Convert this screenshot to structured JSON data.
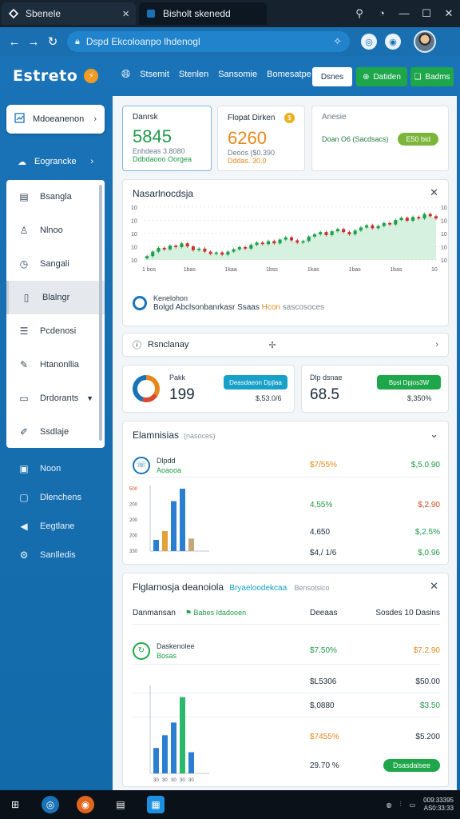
{
  "browser": {
    "tabs": [
      {
        "title": "Sbenele",
        "active": true
      },
      {
        "title": "Bisholt skenedd",
        "active": false
      }
    ],
    "url": "Dspd Ekcoloanpo lhdenogl"
  },
  "app": {
    "logo": "Estreto",
    "top_nav": [
      "Stsemit",
      "Stenlen",
      "Sansomie",
      "Bomesatpe"
    ],
    "buttons": {
      "white": "Dsnes",
      "green1": "Datiden",
      "green2": "Badms"
    }
  },
  "sidebar": {
    "primary": "Mdoeanenon",
    "group": "Eograncke",
    "items": [
      {
        "label": "Bsangla",
        "icon": "document-icon"
      },
      {
        "label": "Nlnoo",
        "icon": "user-icon"
      },
      {
        "label": "Sangali",
        "icon": "clock-icon"
      },
      {
        "label": "Blalngr",
        "icon": "file-icon",
        "selected": true
      },
      {
        "label": "Pcdenosi",
        "icon": "list-icon"
      },
      {
        "label": "Htanonllia",
        "icon": "pen-icon"
      },
      {
        "label": "Drdorants",
        "icon": "folder-icon",
        "chevron": true
      },
      {
        "label": "Ssdlaje",
        "icon": "brush-icon"
      }
    ],
    "lower": [
      {
        "label": "Noon",
        "icon": "image-icon"
      },
      {
        "label": "Dlenchens",
        "icon": "window-icon"
      },
      {
        "label": "Eegtlane",
        "icon": "megaphone-icon"
      },
      {
        "label": "Sanlledis",
        "icon": "gear-icon"
      }
    ]
  },
  "kpis": [
    {
      "label": "Danrsk",
      "value": "5845",
      "sub": "Enhdeas 3.8080",
      "sub2": "Ddbdaooo Oorgea"
    },
    {
      "label": "Flopat Dirken",
      "value": "6260",
      "sub": "Deoos ($0.390",
      "sub2": "Dddas. 30.0"
    },
    {
      "label": "Anesie",
      "row_text": "Doan O6 (Sacdsacs)",
      "pill": "E50 bid"
    }
  ],
  "main_chart": {
    "title": "Nasarlnocdsja",
    "footer_line1": "Kenelohon",
    "footer_line2": "Bolgd Abclsonbanrkasr Ssaas",
    "footer_orange": "Hcon",
    "footer_grey": "sascosoces"
  },
  "chart_data": {
    "type": "candlestick",
    "x_tick_labels": [
      "1 bos",
      "1bas",
      "1kaa",
      "1bss",
      "1kas",
      "1bas",
      "1bas",
      "10"
    ],
    "y_tick_labels": [
      "10",
      "10",
      "10",
      "10",
      "10"
    ],
    "close": [
      2.0,
      2.6,
      3.1,
      2.9,
      3.4,
      3.2,
      3.7,
      3.3,
      2.8,
      3.0,
      2.6,
      2.3,
      2.5,
      2.2,
      2.6,
      2.9,
      3.2,
      3.0,
      3.5,
      3.8,
      3.6,
      4.0,
      3.7,
      4.2,
      4.5,
      4.1,
      3.8,
      4.0,
      4.6,
      4.9,
      5.2,
      4.8,
      5.3,
      5.6,
      5.2,
      4.9,
      5.4,
      5.8,
      6.1,
      5.7,
      6.0,
      6.4,
      6.2,
      6.8,
      7.1,
      6.7,
      7.2,
      7.0,
      7.6,
      7.3,
      7.0
    ]
  },
  "summary_row": {
    "label": "Rsnclanay"
  },
  "mini_cards": [
    {
      "label": "Pakk",
      "value": "199",
      "pill": "Deasdaeon Dpjlaa",
      "sub": "$,53.0/6"
    },
    {
      "label": "Dlp dsnae",
      "value": "68.5",
      "pill": "Bpsi Dpjos3W",
      "sub": "$,350%"
    }
  ],
  "table1": {
    "title": "Elamnisias",
    "subtitle": "(nasoces)",
    "rows": [
      {
        "l1": "Dlpdd",
        "l2": "Aoaooa",
        "mid": "$7/55%",
        "right": "$,5.0.90"
      },
      {
        "l1": "",
        "l2": "",
        "mid": "4,55%",
        "right": "$,2.90"
      },
      {
        "l1": "",
        "l2": "",
        "mid": "4,650",
        "right": "$,2.5%"
      },
      {
        "l1": "",
        "l2": "",
        "mid": "$4,/ 1/6",
        "right": "$,0.96"
      }
    ],
    "bars_y_labels": [
      "500",
      "200",
      "200",
      "200",
      "330"
    ],
    "bars": [
      {
        "value": 0.18,
        "color": "#2a7fd0"
      },
      {
        "value": 0.32,
        "color": "#e0a23a"
      },
      {
        "value": 0.8,
        "color": "#2a7fd0"
      },
      {
        "value": 1.0,
        "color": "#2a7fd0"
      },
      {
        "value": 0.2,
        "color": "#c6a77a"
      }
    ]
  },
  "table2": {
    "title": "Flglarnosja deanoiola",
    "link": "Bryaeloodekcaa",
    "muted": "Bensotsico",
    "header": {
      "c1": "Danmansan",
      "tag": "Babes Idadooen",
      "c2": "Deeaas",
      "c3": "Sosdes 10 Dasins"
    },
    "rows": [
      {
        "l1": "Daskenolee",
        "l2": "Bosas",
        "mid": "$7.50%",
        "right": "$7.2.90"
      },
      {
        "l1": "",
        "l2": "",
        "mid": "$L5306",
        "right": "$50.00"
      },
      {
        "l1": "",
        "l2": "",
        "mid": "$,0880",
        "right": "$3.50"
      },
      {
        "l1": "",
        "l2": "",
        "mid": "$7455%",
        "right": "$5.200"
      },
      {
        "l1": "",
        "l2": "",
        "mid": "29.70 %",
        "right": ""
      }
    ],
    "button": "Dsasdalsee",
    "bars_x_labels": [
      "30",
      "30",
      "30",
      "30",
      "30"
    ],
    "bars": [
      {
        "value": 0.3,
        "color": "#2a7fd0"
      },
      {
        "value": 0.45,
        "color": "#2a7fd0"
      },
      {
        "value": 0.6,
        "color": "#2a7fd0"
      },
      {
        "value": 0.9,
        "color": "#2cb86a"
      },
      {
        "value": 0.25,
        "color": "#2a7fd0"
      }
    ]
  },
  "taskbar": {
    "clock1": "009:33395",
    "clock2": "AS0:33:33"
  }
}
